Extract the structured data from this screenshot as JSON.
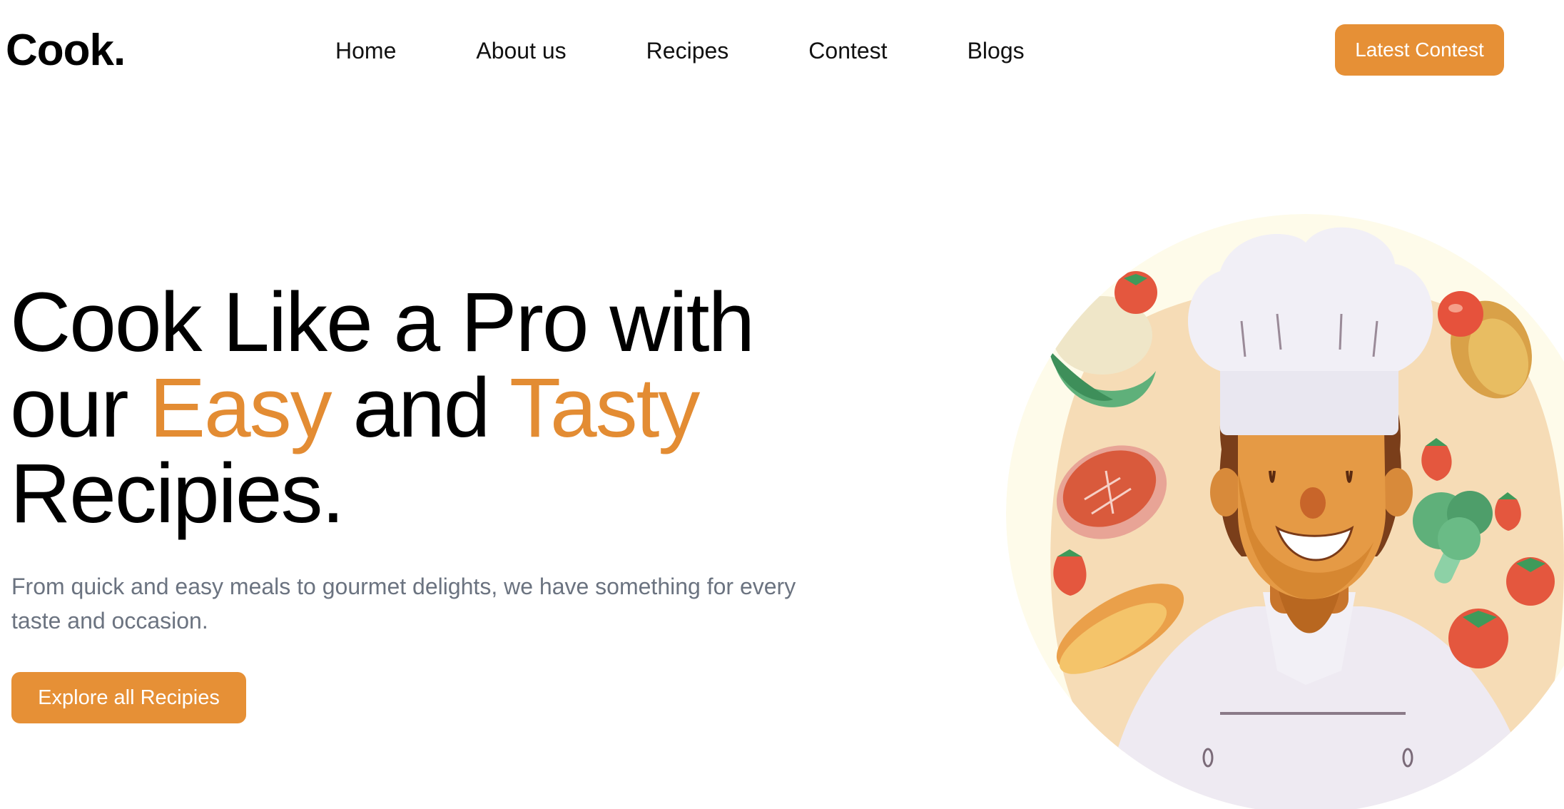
{
  "brand": {
    "logo": "Cook."
  },
  "nav": {
    "items": [
      {
        "label": "Home"
      },
      {
        "label": "About us"
      },
      {
        "label": "Recipes"
      },
      {
        "label": "Contest"
      },
      {
        "label": "Blogs"
      }
    ],
    "cta_label": "Latest Contest"
  },
  "hero": {
    "title_line1": "Cook Like a Pro with",
    "title_our": "our ",
    "title_easy": "Easy",
    "title_and": " and ",
    "title_tasty": "Tasty",
    "title_line3": "Recipies.",
    "subtitle": "From quick and easy meals to gourmet delights, we have something for every taste and occasion.",
    "cta_label": "Explore all Recipies"
  },
  "illustration": {
    "subject": "chef-with-food-illustration",
    "items": [
      "chef",
      "chef-hat",
      "cauliflower",
      "steak",
      "bread",
      "broccoli",
      "tomato",
      "strawberry",
      "potato",
      "apple"
    ]
  },
  "colors": {
    "accent": "#e69036",
    "accent_text": "#e38c33",
    "text": "#000000",
    "muted": "#6b7380",
    "background": "#ffffff"
  }
}
